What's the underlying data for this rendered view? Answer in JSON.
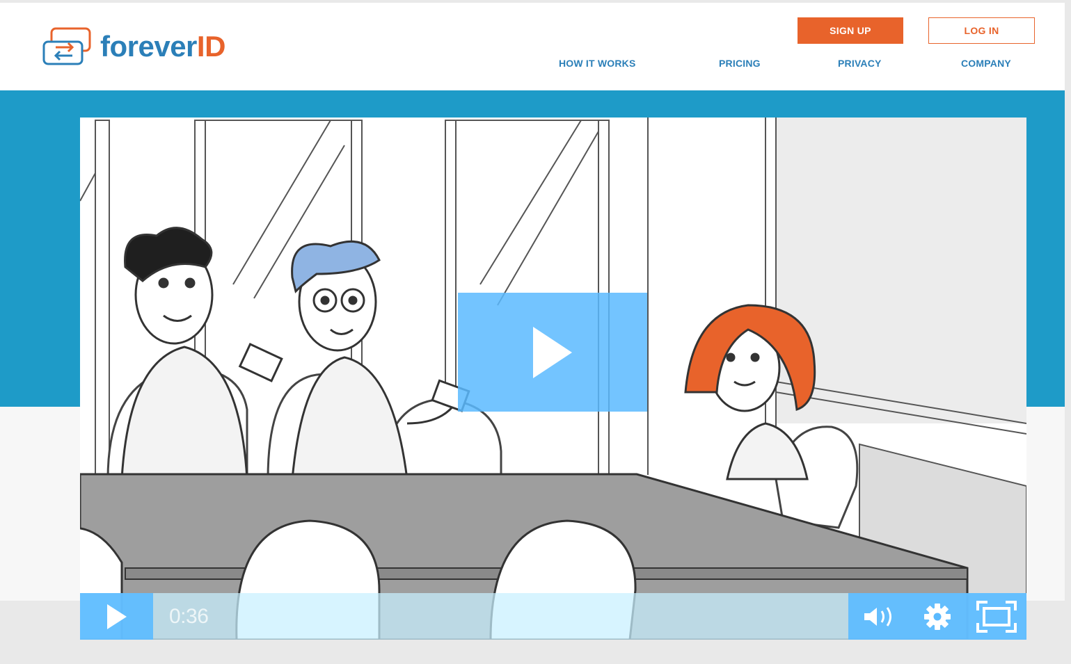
{
  "brand": {
    "name_part1": "forever",
    "name_part2": "ID",
    "primary_color": "#2b7fb8",
    "accent_color": "#e8632b",
    "logo_icon": "swap-arrows-logo-icon"
  },
  "header": {
    "signup_label": "SIGN UP",
    "login_label": "LOG IN",
    "nav": [
      {
        "label": "HOW IT WORKS"
      },
      {
        "label": "PRICING"
      },
      {
        "label": "PRIVACY"
      },
      {
        "label": "COMPANY"
      }
    ]
  },
  "hero": {
    "band_color": "#1e9bc8"
  },
  "video": {
    "time": "0:36",
    "icons": {
      "big_play": "play-icon",
      "control_play": "play-icon",
      "volume": "volume-icon",
      "settings": "gear-icon",
      "fullscreen": "fullscreen-icon"
    }
  }
}
